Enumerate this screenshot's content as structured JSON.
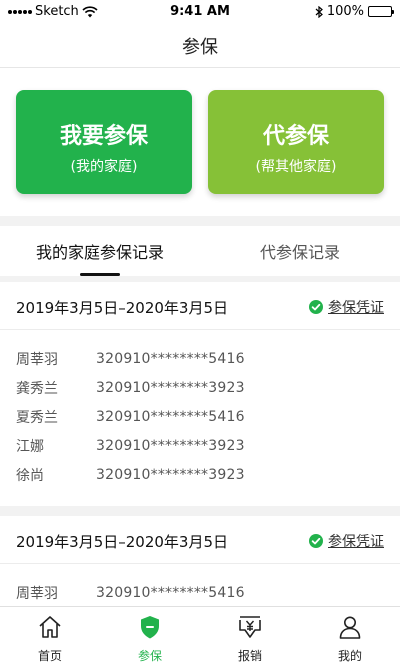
{
  "status_bar": {
    "carrier": "Sketch",
    "time": "9:41 AM",
    "battery": "100%"
  },
  "nav": {
    "title": "参保"
  },
  "actions": [
    {
      "title": "我要参保",
      "subtitle": "(我的家庭)",
      "color": "#22b24c"
    },
    {
      "title": "代参保",
      "subtitle": "(帮其他家庭)",
      "color": "#86c137"
    }
  ],
  "tabs": [
    {
      "label": "我的家庭参保记录",
      "active": true
    },
    {
      "label": "代参保记录",
      "active": false
    }
  ],
  "records": [
    {
      "period": "2019年3月5日–2020年3月5日",
      "cert_label": "参保凭证",
      "members": [
        {
          "name": "周莘羽",
          "id": "320910********5416"
        },
        {
          "name": "龚秀兰",
          "id": "320910********3923"
        },
        {
          "name": "夏秀兰",
          "id": "320910********5416"
        },
        {
          "name": "江娜",
          "id": "320910********3923"
        },
        {
          "name": "徐尚",
          "id": "320910********3923"
        }
      ]
    },
    {
      "period": "2019年3月5日–2020年3月5日",
      "cert_label": "参保凭证",
      "members": [
        {
          "name": "周莘羽",
          "id": "320910********5416"
        }
      ]
    }
  ],
  "tab_bar": [
    {
      "label": "首页",
      "icon": "home-icon",
      "active": false
    },
    {
      "label": "参保",
      "icon": "shield-icon",
      "active": true
    },
    {
      "label": "报销",
      "icon": "reimburse-icon",
      "active": false
    },
    {
      "label": "我的",
      "icon": "person-icon",
      "active": false
    }
  ],
  "colors": {
    "primary": "#22b24c",
    "secondary": "#86c137"
  }
}
